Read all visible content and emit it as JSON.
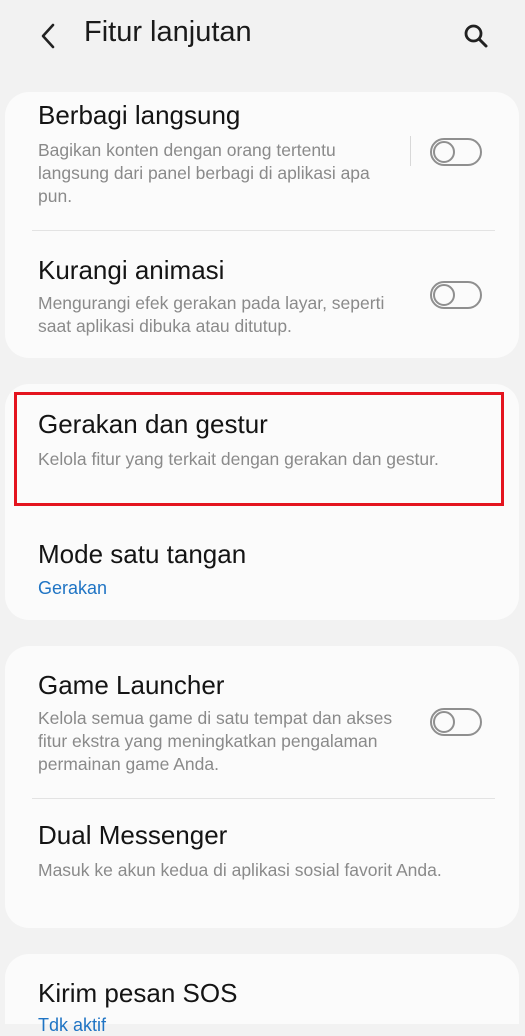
{
  "header": {
    "title": "Fitur lanjutan",
    "back_icon": "back-arrow-icon",
    "search_icon": "search-icon"
  },
  "groups": [
    {
      "items": [
        {
          "title": "Berbagi langsung",
          "desc": "Bagikan konten dengan orang tertentu langsung dari panel berbagi di aplikasi apa pun.",
          "toggle": "off"
        },
        {
          "title": "Kurangi animasi",
          "desc": "Mengurangi efek gerakan pada layar, seperti saat aplikasi dibuka atau ditutup.",
          "toggle": "off"
        }
      ]
    },
    {
      "items": [
        {
          "title": "Gerakan dan gestur",
          "desc": "Kelola fitur yang terkait dengan gerakan dan gestur."
        },
        {
          "title": "Mode satu tangan",
          "sub": "Gerakan"
        }
      ]
    },
    {
      "items": [
        {
          "title": "Game Launcher",
          "desc": "Kelola semua game di satu tempat dan akses fitur ekstra yang meningkatkan pengalaman permainan game Anda.",
          "toggle": "off"
        },
        {
          "title": "Dual Messenger",
          "desc": "Masuk ke akun kedua di aplikasi sosial favorit Anda."
        }
      ]
    },
    {
      "items": [
        {
          "title": "Kirim pesan SOS",
          "sub": "Tdk aktif"
        }
      ]
    }
  ],
  "colors": {
    "accent": "#1f74c4",
    "highlight": "#e4141e",
    "background": "#f2f2f2",
    "card": "#fbfbfb"
  }
}
